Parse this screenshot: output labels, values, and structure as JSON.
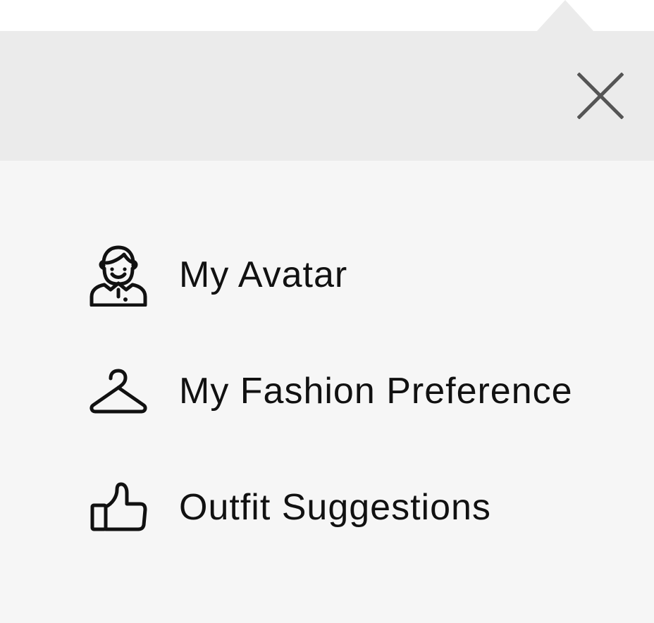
{
  "menu": {
    "close_icon": "close-icon",
    "items": [
      {
        "id": "my-avatar",
        "label": "My Avatar",
        "icon": "avatar-icon"
      },
      {
        "id": "my-fashion-preference",
        "label": "My Fashion Preference",
        "icon": "hanger-icon"
      },
      {
        "id": "outfit-suggestions",
        "label": "Outfit Suggestions",
        "icon": "thumbs-up-icon"
      }
    ]
  },
  "colors": {
    "header_background": "#ebebeb",
    "body_background": "#f6f6f6",
    "icon_stroke": "#111111",
    "close_icon": "#555555"
  }
}
